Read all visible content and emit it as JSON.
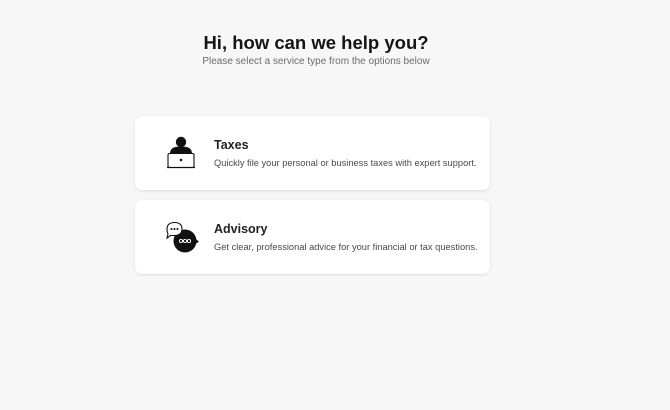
{
  "header": {
    "title": "Hi, how can we help you?",
    "subtitle": "Please select a service type from the options below"
  },
  "services": [
    {
      "title": "Taxes",
      "description": "Quickly file your personal or business taxes with expert support.",
      "icon": "person-at-laptop-icon"
    },
    {
      "title": "Advisory",
      "description": "Get clear, professional advice for your financial or tax questions.",
      "icon": "chat-bubbles-icon"
    }
  ]
}
